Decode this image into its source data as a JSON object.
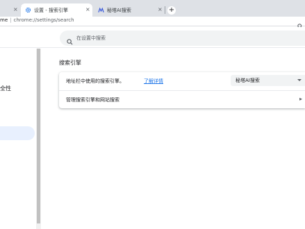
{
  "browser": {
    "tabs": [
      {
        "title": "",
        "close": "×"
      },
      {
        "title": "设置 - 搜索引擎",
        "close": "×",
        "icon": "gear-icon"
      },
      {
        "title": "秘塔AI搜索",
        "close": "×",
        "icon": "metaso-logo-icon"
      }
    ],
    "new_tab": "+",
    "address": {
      "host": "me",
      "separator": "|",
      "path": "chrome://settings/search"
    }
  },
  "settings": {
    "search_placeholder": "在设置中搜索",
    "sidebar": {
      "items": [
        {
          "label": "安全性"
        }
      ]
    },
    "section": {
      "title": "搜索引擎",
      "rows": [
        {
          "label": "地址栏中使用的搜索引擎。",
          "link": "了解详情",
          "select_value": "秘塔AI搜索"
        },
        {
          "label": "管理搜索引擎和网站搜索",
          "arrow": "▸"
        }
      ]
    }
  },
  "colors": {
    "accent": "#1a73e8",
    "tabstrip": "#dee1e6",
    "selected_nav": "#e8f0fe"
  }
}
